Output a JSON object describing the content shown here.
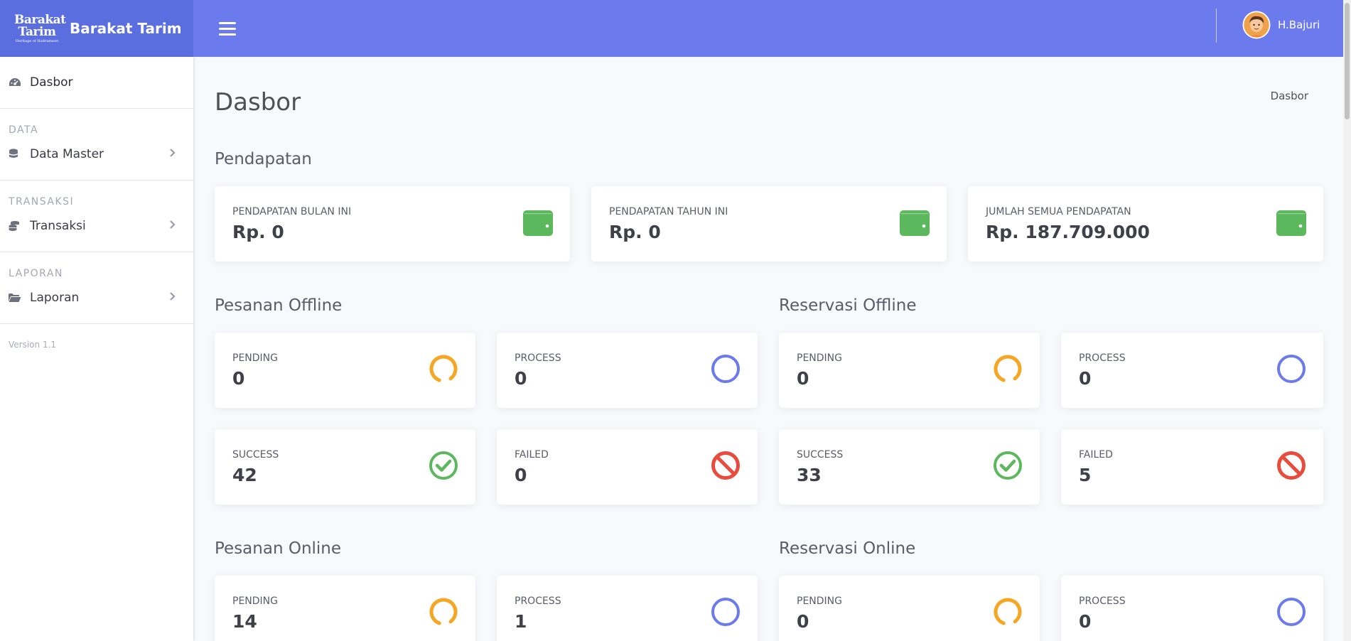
{
  "brand": {
    "logo_line1": "Barakat",
    "logo_line2": "Tarim",
    "logo_tagline": "Heritage of Hadramawt",
    "name": "Barakat Tarim"
  },
  "topbar": {
    "user_name": "H.Bajuri"
  },
  "sidebar": {
    "dashboard_label": "Dasbor",
    "headings": [
      "DATA",
      "TRANSAKSI",
      "LAPORAN"
    ],
    "items": [
      {
        "label": "Data Master"
      },
      {
        "label": "Transaksi"
      },
      {
        "label": "Laporan"
      }
    ],
    "version": "Version 1.1"
  },
  "page": {
    "title": "Dasbor",
    "breadcrumb": "Dasbor"
  },
  "sections": {
    "pendapatan": "Pendapatan",
    "pesanan_offline": "Pesanan Offline",
    "reservasi_offline": "Reservasi Offline",
    "pesanan_online": "Pesanan Online",
    "reservasi_online": "Reservasi Online"
  },
  "income_cards": [
    {
      "label": "PENDAPATAN BULAN INI",
      "value": "Rp. 0"
    },
    {
      "label": "PENDAPATAN TAHUN INI",
      "value": "Rp. 0"
    },
    {
      "label": "JUMLAH SEMUA PENDAPATAN",
      "value": "Rp. 187.709.000"
    }
  ],
  "pesanan_offline": {
    "pending": {
      "label": "PENDING",
      "value": "0"
    },
    "process": {
      "label": "PROCESS",
      "value": "0"
    },
    "success": {
      "label": "SUCCESS",
      "value": "42"
    },
    "failed": {
      "label": "FAILED",
      "value": "0"
    }
  },
  "reservasi_offline": {
    "pending": {
      "label": "PENDING",
      "value": "0"
    },
    "process": {
      "label": "PROCESS",
      "value": "0"
    },
    "success": {
      "label": "SUCCESS",
      "value": "33"
    },
    "failed": {
      "label": "FAILED",
      "value": "5"
    }
  },
  "pesanan_online": {
    "pending": {
      "label": "PENDING",
      "value": "14"
    },
    "process": {
      "label": "PROCESS",
      "value": "1"
    }
  },
  "reservasi_online": {
    "pending": {
      "label": "PENDING",
      "value": "0"
    },
    "process": {
      "label": "PROCESS",
      "value": "0"
    }
  },
  "colors": {
    "brand": "#5a6ee0",
    "topbar": "#6b7bed",
    "wallet": "#5cb85c",
    "pending": "#f5a623",
    "process": "#6b7bed",
    "success": "#5cb85c",
    "failed": "#e74c3c"
  },
  "icons": {
    "dashboard": "tachometer-icon",
    "data_master": "database-icon",
    "transaksi": "coins-icon",
    "laporan": "folder-open-icon",
    "wallet": "wallet-icon",
    "pending": "spinner-icon",
    "process": "circle-icon",
    "success": "check-circle-icon",
    "failed": "ban-icon"
  }
}
